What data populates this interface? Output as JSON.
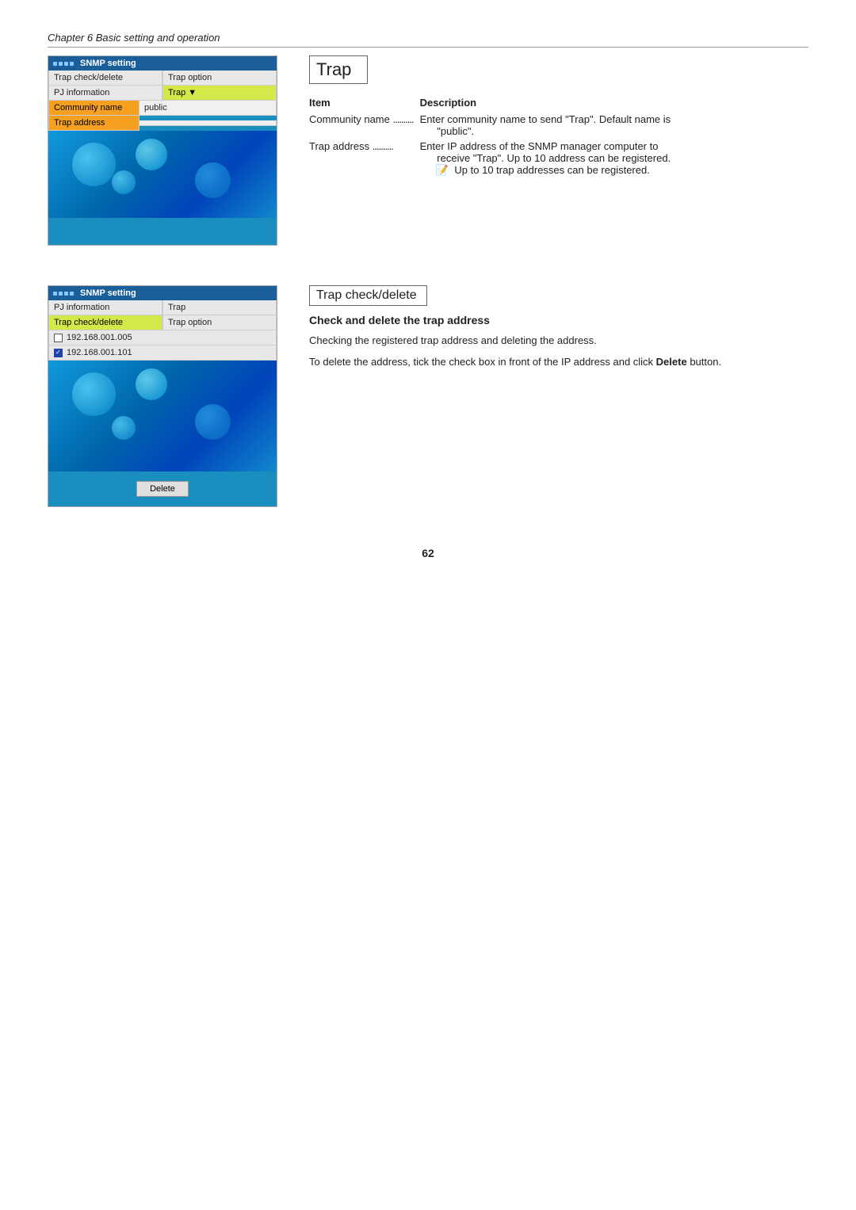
{
  "chapter_header": "Chapter 6 Basic setting and operation",
  "section1": {
    "snmp_title": "SNMP setting",
    "menu": [
      {
        "label": "Trap check/delete",
        "style": "light"
      },
      {
        "label": "Trap option",
        "style": "light"
      }
    ],
    "row2": [
      {
        "label": "PJ information",
        "style": "light"
      },
      {
        "label": "Trap",
        "style": "active-blue",
        "cursor": true
      }
    ],
    "fields": [
      {
        "label": "Community name",
        "label_style": "orange",
        "value": "public"
      },
      {
        "label": "Trap address",
        "label_style": "orange",
        "value": ""
      }
    ],
    "heading": "Trap",
    "table": {
      "col1": "Item",
      "col2": "Description"
    },
    "items": [
      {
        "item": "Community name",
        "dots": "..........",
        "description": "Enter community name to send \"Trap\". Default name is\n\"public\"."
      },
      {
        "item": "Trap address",
        "dots": "..........",
        "description": "Enter IP address of the SNMP manager computer to\nreceive \"Trap\". Up to 10 address can be registered."
      }
    ],
    "note": "Up to 10 trap addresses can be registered."
  },
  "section2": {
    "snmp_title": "SNMP setting",
    "row1": [
      {
        "label": "PJ information",
        "style": "light"
      },
      {
        "label": "Trap",
        "style": "light"
      }
    ],
    "row2": [
      {
        "label": "Trap check/delete",
        "style": "active-orange"
      },
      {
        "label": "Trap option",
        "style": "light"
      }
    ],
    "addresses": [
      {
        "checked": false,
        "ip": "192.168.001.005"
      },
      {
        "checked": true,
        "ip": "192.168.001.101"
      }
    ],
    "delete_btn": "Delete",
    "heading": "Trap check/delete",
    "subheading": "Check and delete the trap address",
    "desc1": "Checking the registered trap address and deleting the address.",
    "desc2": "To delete the address, tick the check box in front of the IP address and click ",
    "desc2_bold": "Delete",
    "desc2_end": " button."
  },
  "page_number": "62"
}
